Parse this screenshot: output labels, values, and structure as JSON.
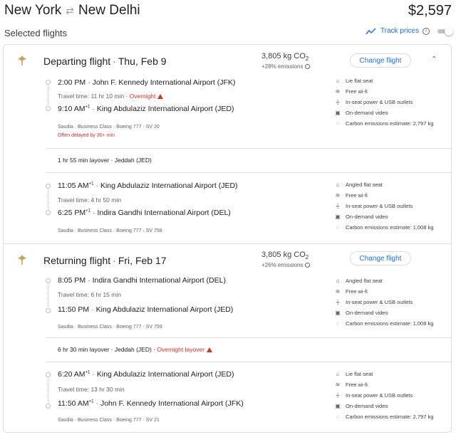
{
  "header": {
    "origin": "New York",
    "destination": "New Delhi",
    "swap_icon": "swap-arrows-icon",
    "price": "$2,597"
  },
  "selected_label": "Selected flights",
  "track_prices": {
    "label": "Track prices",
    "enabled": false
  },
  "colors": {
    "accent": "#1a73e8",
    "warning": "#d93025",
    "muted": "#5f6368",
    "border": "#dadce0"
  },
  "departing": {
    "title": "Departing flight",
    "date": "Thu, Feb 9",
    "co2": "3,805 kg CO",
    "co2_sub": "2",
    "co2_pct": "+28% emissions",
    "change_label": "Change flight",
    "legs": [
      {
        "dep_time": "2:00 PM",
        "dep_time_sup": "",
        "dep_airport": "John F. Kennedy International Airport (JFK)",
        "travel_time": "Travel time: 11 hr 10 min",
        "travel_warn": "Overnight",
        "arr_time": "9:10 AM",
        "arr_time_sup": "+1",
        "arr_airport": "King Abdulaziz International Airport (JED)",
        "meta": "Saudia · Business Class · Boeing 777 · SV 20",
        "delay": "Often delayed by 30+ min",
        "amenities": [
          "Lie flat seat",
          "Free wi-fi",
          "In-seat power & USB outlets",
          "On-demand video",
          "Carbon emissions estimate: 2,797 kg"
        ]
      },
      {
        "dep_time": "11:05 AM",
        "dep_time_sup": "+1",
        "dep_airport": "King Abdulaziz International Airport (JED)",
        "travel_time": "Travel time: 4 hr 50 min",
        "travel_warn": "",
        "arr_time": "6:25 PM",
        "arr_time_sup": "+1",
        "arr_airport": "Indira Gandhi International Airport (DEL)",
        "meta": "Saudia · Business Class · Boeing 777 · SV 758",
        "delay": "",
        "amenities": [
          "Angled flat seat",
          "Free wi-fi",
          "In-seat power & USB outlets",
          "On-demand video",
          "Carbon emissions estimate: 1,008 kg"
        ]
      }
    ],
    "layover": "1 hr 55 min layover · Jeddah (JED)",
    "layover_warn": ""
  },
  "returning": {
    "title": "Returning flight",
    "date": "Fri, Feb 17",
    "co2": "3,805 kg CO",
    "co2_sub": "2",
    "co2_pct": "+26% emissions",
    "change_label": "Change flight",
    "legs": [
      {
        "dep_time": "8:05 PM",
        "dep_time_sup": "",
        "dep_airport": "Indira Gandhi International Airport (DEL)",
        "travel_time": "Travel time: 6 hr 15 min",
        "travel_warn": "",
        "arr_time": "11:50 PM",
        "arr_time_sup": "",
        "arr_airport": "King Abdulaziz International Airport (JED)",
        "meta": "Saudia · Business Class · Boeing 777 · SV 759",
        "delay": "",
        "amenities": [
          "Angled flat seat",
          "Free wi-fi",
          "In-seat power & USB outlets",
          "On-demand video",
          "Carbon emissions estimate: 1,008 kg"
        ]
      },
      {
        "dep_time": "6:20 AM",
        "dep_time_sup": "+1",
        "dep_airport": "King Abdulaziz International Airport (JED)",
        "travel_time": "Travel time: 13 hr 30 min",
        "travel_warn": "",
        "arr_time": "11:50 AM",
        "arr_time_sup": "+1",
        "arr_airport": "John F. Kennedy International Airport (JFK)",
        "meta": "Saudia · Business Class · Boeing 777 · SV 21",
        "delay": "",
        "amenities": [
          "Lie flat seat",
          "Free wi-fi",
          "In-seat power & USB outlets",
          "On-demand video",
          "Carbon emissions estimate: 2,797 kg"
        ]
      }
    ],
    "layover": "6 hr 30 min layover · Jeddah (JED) · ",
    "layover_warn": "Overnight layover"
  },
  "amenity_icons": [
    "seat-icon",
    "wifi-icon",
    "power-outlet-icon",
    "video-icon",
    "co2-icon"
  ]
}
